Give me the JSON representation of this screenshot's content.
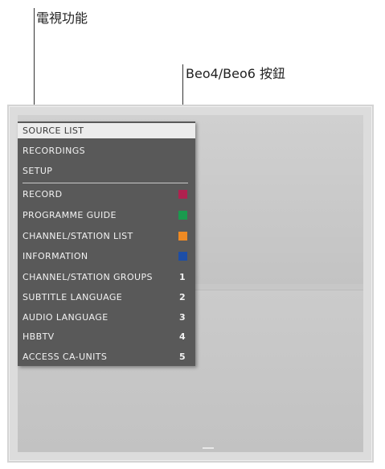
{
  "callouts": {
    "tv_functions": "電視功能",
    "buttons": "Beo4/Beo6 按鈕"
  },
  "menu": {
    "items": [
      {
        "label": "SOURCE LIST",
        "selected": true
      },
      {
        "label": "RECORDINGS"
      },
      {
        "label": "SETUP"
      },
      {
        "label": "RECORD",
        "color": "#b0214f"
      },
      {
        "label": "PROGRAMME GUIDE",
        "color": "#1a9a4e"
      },
      {
        "label": "CHANNEL/STATION LIST",
        "color": "#ef8a23"
      },
      {
        "label": "INFORMATION",
        "color": "#1d4ea6"
      },
      {
        "label": "CHANNEL/STATION GROUPS",
        "key": "1"
      },
      {
        "label": "SUBTITLE LANGUAGE",
        "key": "2"
      },
      {
        "label": "AUDIO LANGUAGE",
        "key": "3"
      },
      {
        "label": "HBBTV",
        "key": "4"
      },
      {
        "label": "ACCESS CA-UNITS",
        "key": "5"
      }
    ]
  }
}
